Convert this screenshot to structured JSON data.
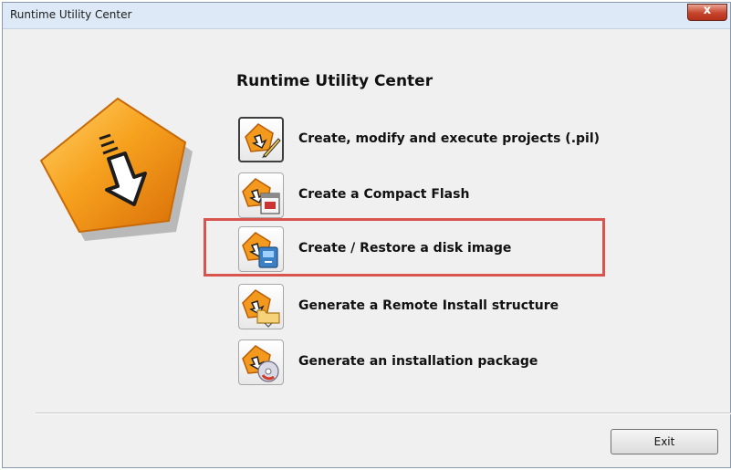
{
  "window": {
    "title": "Runtime Utility Center",
    "close_label": "x"
  },
  "heading": "Runtime Utility Center",
  "items": [
    {
      "label": "Create, modify and execute projects (.pil)",
      "icon": "project-pencil-icon",
      "selected": true
    },
    {
      "label": "Create a Compact Flash",
      "icon": "compact-flash-icon",
      "selected": false
    },
    {
      "label": "Create / Restore a disk image",
      "icon": "disk-image-icon",
      "selected": false
    },
    {
      "label": "Generate a Remote Install structure",
      "icon": "remote-install-folder-icon",
      "selected": false
    },
    {
      "label": "Generate an installation package",
      "icon": "installation-package-cd-icon",
      "selected": false
    }
  ],
  "footer": {
    "exit_label": "Exit"
  },
  "colors": {
    "accent_orange": "#f39a1e",
    "highlight_red": "#d9534f",
    "title_bar": "#dde9f6"
  }
}
